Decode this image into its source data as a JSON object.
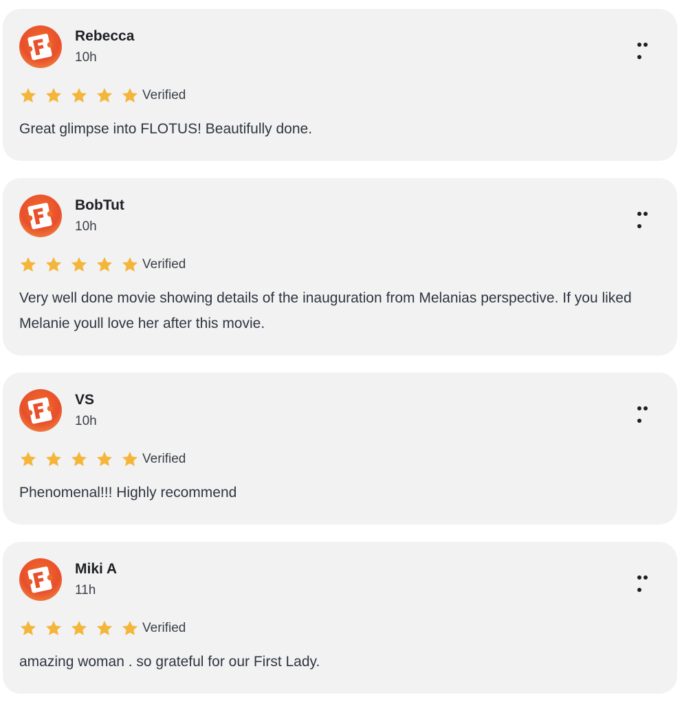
{
  "reviews": [
    {
      "name": "Rebecca",
      "time": "10h",
      "stars": 5,
      "verified_label": "Verified",
      "text": "Great glimpse into FLOTUS! Beautifully done.",
      "avatar_icon": "fandango-logo-icon"
    },
    {
      "name": "BobTut",
      "time": "10h",
      "stars": 5,
      "verified_label": "Verified",
      "text": "Very well done movie showing details of the inauguration from Melanias perspective. If you liked Melanie youll love her after this movie.",
      "avatar_icon": "fandango-logo-icon"
    },
    {
      "name": "VS",
      "time": "10h",
      "stars": 5,
      "verified_label": "Verified",
      "text": "Phenomenal!!! Highly recommend",
      "avatar_icon": "fandango-logo-icon"
    },
    {
      "name": "Miki A",
      "time": "11h",
      "stars": 5,
      "verified_label": "Verified",
      "text": "amazing woman . so grateful for our First Lady.",
      "avatar_icon": "fandango-logo-icon"
    }
  ],
  "colors": {
    "star": "#f4b63a",
    "card_bg": "#f2f2f2",
    "brand": "#e84f2c"
  }
}
